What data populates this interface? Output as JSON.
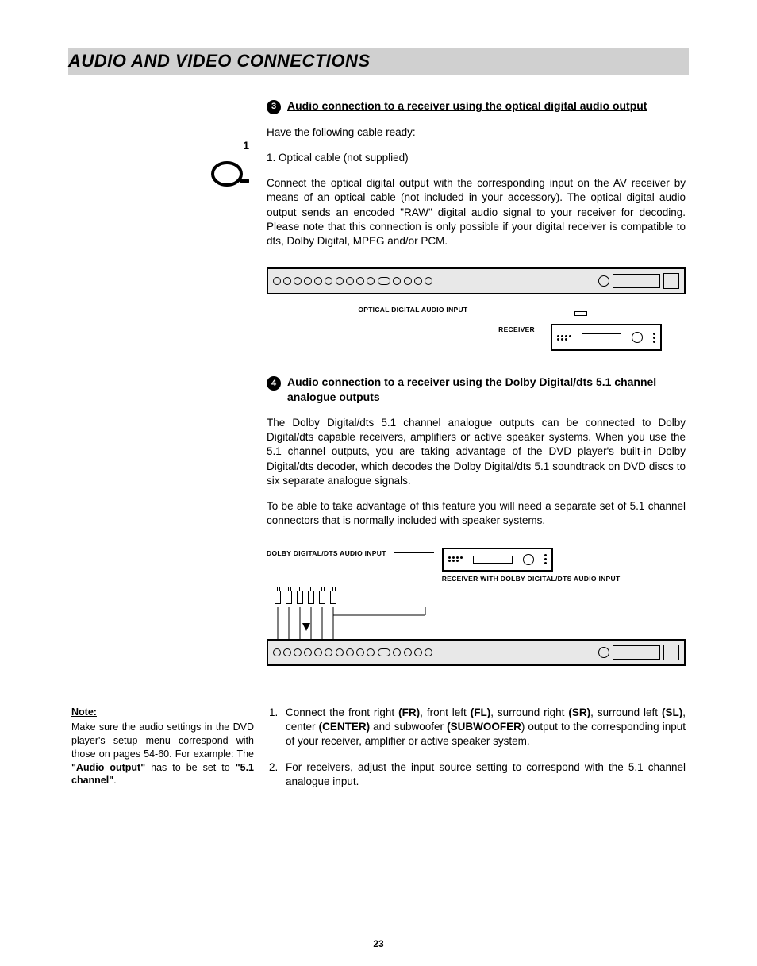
{
  "header": {
    "title": "AUDIO AND VIDEO CONNECTIONS"
  },
  "side": {
    "cable_number": "1"
  },
  "section3": {
    "number": "3",
    "title": "Audio connection to a receiver using the optical digital audio output",
    "intro": "Have the following cable ready:",
    "cable_item": "1. Optical cable (not supplied)",
    "body": "Connect the optical digital output with the corresponding input on the AV receiver by means of an optical cable (not included in your accessory). The optical digital audio output sends an encoded \"RAW\" digital audio signal to your receiver for decoding. Please note that this connection is only possible if your digital receiver is compatible to dts, Dolby Digital, MPEG and/or PCM.",
    "diagram": {
      "label_input": "OPTICAL DIGITAL AUDIO INPUT",
      "label_receiver": "RECEIVER"
    }
  },
  "section4": {
    "number": "4",
    "title": "Audio connection to a receiver using the Dolby Digital/dts 5.1 channel analogue outputs",
    "p1": "The Dolby Digital/dts 5.1 channel analogue outputs can be connected to Dolby Digital/dts capable receivers, amplifiers or active speaker systems. When you use the 5.1 channel outputs, you are taking advantage of the DVD player's built-in Dolby Digital/dts decoder, which decodes the Dolby Digital/dts 5.1 soundtrack on DVD discs to six separate analogue signals.",
    "p2": "To be able to take advantage of this feature you will need a separate set of 5.1 channel connectors that is normally included with speaker systems.",
    "diagram": {
      "label_input": "DOLBY DIGITAL/DTS AUDIO INPUT",
      "label_receiver": "RECEIVER WITH DOLBY DIGITAL/DTS AUDIO INPUT"
    },
    "steps": {
      "s1_a": "Connect the front right ",
      "s1_fr": "(FR)",
      "s1_b": ", front left ",
      "s1_fl": "(FL)",
      "s1_c": ", surround right ",
      "s1_sr": "(SR)",
      "s1_d": ", surround left ",
      "s1_sl": "(SL)",
      "s1_e": ", center ",
      "s1_center": "(CENTER)",
      "s1_f": " and subwoofer ",
      "s1_sub": "(SUBWOOFER",
      "s1_g": ") output to the corresponding input of your receiver, amplifier or active speaker system.",
      "s2": "For receivers, adjust the input source setting to correspond with the 5.1 channel analogue input."
    }
  },
  "note": {
    "title": "Note:",
    "a": "Make sure the audio settings in the DVD player's setup menu correspond with those on pages 54-60. For example: The ",
    "bold1": "\"Audio output\"",
    "b": " has to be set to ",
    "bold2": "\"5.1 channel\"",
    "c": "."
  },
  "page_number": "23"
}
